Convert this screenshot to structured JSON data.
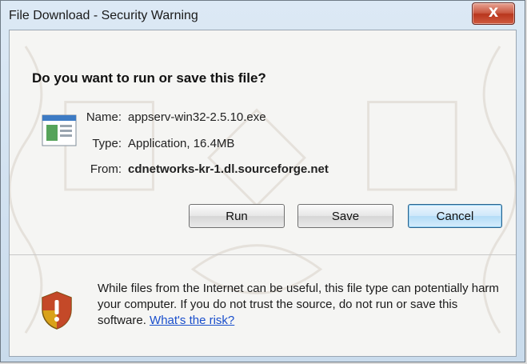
{
  "window": {
    "title": "File Download - Security Warning",
    "close_glyph": "X"
  },
  "dialog": {
    "question": "Do you want to run or save this file?",
    "file_icon": "application-file-icon",
    "fields": {
      "name_label": "Name:",
      "name_value": "appserv-win32-2.5.10.exe",
      "type_label": "Type:",
      "type_value": "Application, 16.4MB",
      "from_label": "From:",
      "from_value": "cdnetworks-kr-1.dl.sourceforge.net"
    },
    "buttons": {
      "run": "Run",
      "save": "Save",
      "cancel": "Cancel"
    },
    "warning": {
      "icon": "security-shield-icon",
      "text": "While files from the Internet can be useful, this file type can potentially harm your computer. If you do not trust the source, do not run or save this software.",
      "link": "What's the risk?"
    }
  },
  "colors": {
    "link": "#1a4fcc",
    "close_button": "#c8553e",
    "default_button_border": "#2c628b"
  }
}
